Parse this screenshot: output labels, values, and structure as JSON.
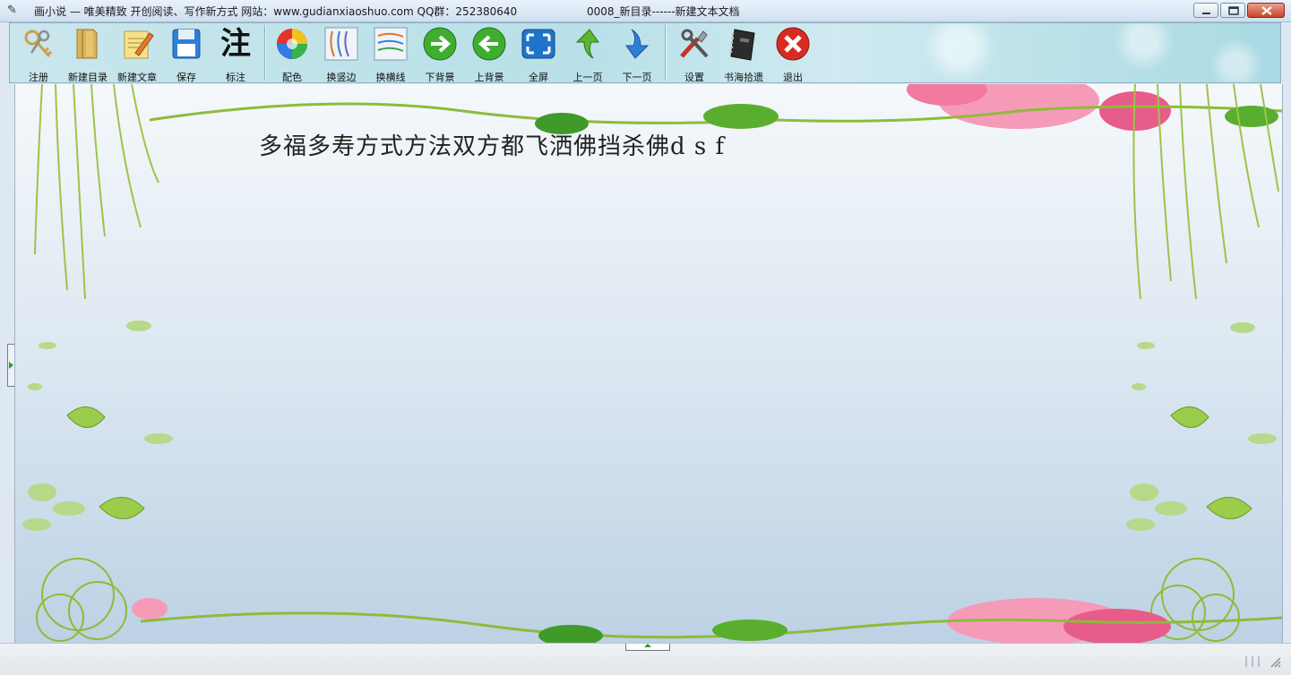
{
  "window": {
    "app_icon": "book-icon",
    "title": "画小说 — 唯美精致 开创阅读、写作新方式 网站：www.gudianxiaoshuo.com QQ群：252380640",
    "document_title": "0008_新目录------新建文本文档"
  },
  "toolbar": {
    "items": [
      {
        "label": "注册",
        "icon": "keys-icon"
      },
      {
        "label": "新建目录",
        "icon": "folder-icon"
      },
      {
        "label": "新建文章",
        "icon": "notepad-pencil-icon"
      },
      {
        "label": "保存",
        "icon": "floppy-disk-icon"
      },
      {
        "label": "标注",
        "icon": "annotate-character-icon",
        "glyph": "注"
      },
      {
        "label": "配色",
        "icon": "color-wheel-icon"
      },
      {
        "label": "换竖边",
        "icon": "vertical-border-icon"
      },
      {
        "label": "换横线",
        "icon": "horizontal-lines-icon"
      },
      {
        "label": "下背景",
        "icon": "arrow-right-circle-icon"
      },
      {
        "label": "上背景",
        "icon": "arrow-left-circle-icon"
      },
      {
        "label": "全屏",
        "icon": "fullscreen-icon"
      },
      {
        "label": "上一页",
        "icon": "arrow-up-icon"
      },
      {
        "label": "下一页",
        "icon": "arrow-down-icon"
      },
      {
        "label": "设置",
        "icon": "tools-icon"
      },
      {
        "label": "书海拾遗",
        "icon": "notebook-icon"
      },
      {
        "label": "退出",
        "icon": "exit-x-icon"
      }
    ]
  },
  "editor": {
    "content": "多福多寿方式方法双方都飞洒佛挡杀佛d s f"
  },
  "colors": {
    "toolbar_bg": "#b8e0e8",
    "canvas_top": "#f5f8fb",
    "canvas_bottom": "#bcd2e4",
    "vine_green": "#8dbb3a",
    "flower_pink": "#f27aa0"
  }
}
